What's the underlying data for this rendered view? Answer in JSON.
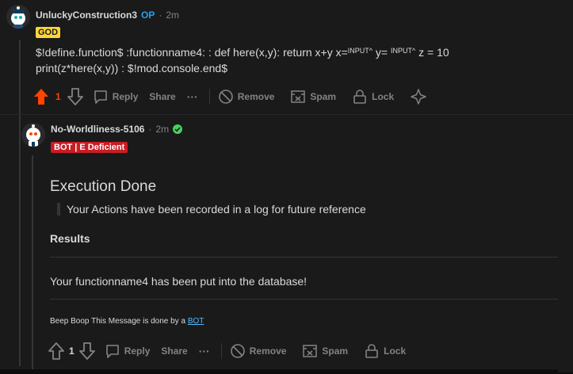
{
  "comment1": {
    "username": "UnluckyConstruction3",
    "op_badge": "OP",
    "separator": "·",
    "time": "2m",
    "flair": "GOD",
    "line1_a": "$!define.function$ :functionname4: : def here(x,y): return x+y x=",
    "line1_sup1": "INPUT^",
    "line1_b": " y= ",
    "line1_sup2": "INPUT^",
    "line1_c": " z = 10",
    "line2": "print(z*here(x,y)) : $!mod.console.end$",
    "actions": {
      "score": "1",
      "reply": "Reply",
      "share": "Share",
      "more": "···",
      "remove": "Remove",
      "spam": "Spam",
      "lock": "Lock"
    }
  },
  "comment2": {
    "username": "No-Worldliness-5106",
    "separator": "·",
    "time": "2m",
    "flair": "BOT | E Deficient",
    "heading": "Execution Done",
    "quote": "Your Actions have been recorded in a log for future reference",
    "results_label": "Results",
    "result_text": "Your functionname4 has been put into the database!",
    "footer_prefix": "Beep Boop This Message is done by a ",
    "footer_link": "BOT",
    "actions": {
      "score": "1",
      "reply": "Reply",
      "share": "Share",
      "more": "···",
      "remove": "Remove",
      "spam": "Spam",
      "lock": "Lock"
    }
  },
  "colors": {
    "upvote_active": "#ff4500",
    "op": "#24a0ed",
    "god_flair": "#ffd635",
    "bot_flair": "#c81d25",
    "verified": "#46d160",
    "link": "#4fbcff"
  },
  "icons": [
    "upvote-icon",
    "downvote-icon",
    "comment-icon",
    "ban-icon",
    "spam-icon",
    "lock-icon",
    "approve-icon",
    "verified-icon"
  ]
}
